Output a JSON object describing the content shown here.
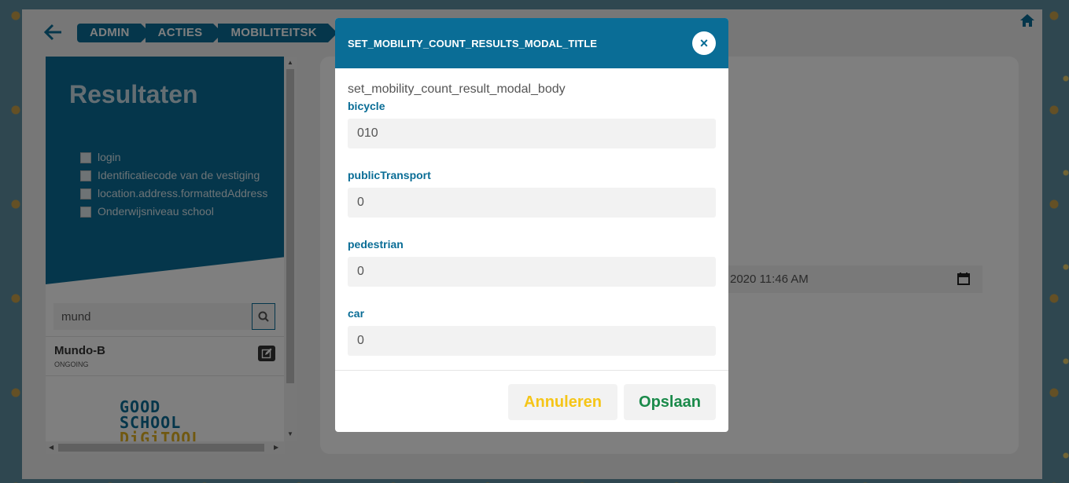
{
  "breadcrumb": [
    "ADMIN",
    "ACTIES",
    "MOBILITEITSK"
  ],
  "sidebar": {
    "title": "Resultaten",
    "filters": [
      "login",
      "Identificatiecode van de vestiging",
      "location.address.formattedAddress",
      "Onderwijsniveau school"
    ],
    "search_value": "mund",
    "results": [
      {
        "name": "Mundo-B",
        "status": "ONGOING"
      }
    ],
    "logo_lines": [
      "GOOD",
      "SCHOOL",
      "DiGiTOOL"
    ]
  },
  "main": {
    "date_value": "2020 11:46 AM"
  },
  "modal": {
    "title": "SET_MOBILITY_COUNT_RESULTS_MODAL_TITLE",
    "body": "set_mobility_count_result_modal_body",
    "fields": [
      {
        "label": "bicycle",
        "value": "010"
      },
      {
        "label": "publicTransport",
        "value": "0"
      },
      {
        "label": "pedestrian",
        "value": "0"
      },
      {
        "label": "car",
        "value": "0"
      }
    ],
    "cancel_label": "Annuleren",
    "save_label": "Opslaan",
    "close_symbol": "×"
  },
  "colors": {
    "primary": "#0a6d96",
    "cancel": "#f5c518",
    "save": "#1a8a4a"
  },
  "icons": [
    "back-arrow-icon",
    "home-icon",
    "search-icon",
    "edit-icon",
    "calendar-icon",
    "close-icon"
  ]
}
